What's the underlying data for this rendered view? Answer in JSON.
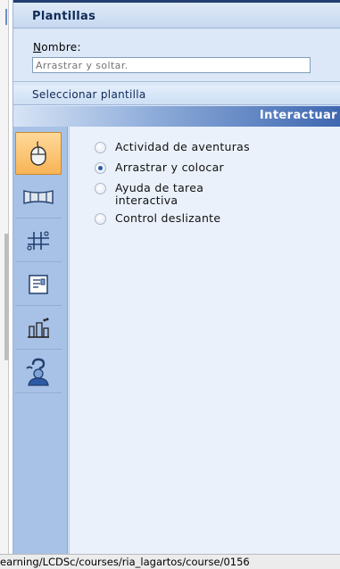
{
  "panel": {
    "title": "Plantillas",
    "name_label_accel": "N",
    "name_label_rest": "ombre:",
    "name_input_placeholder": "Arrastrar y soltar.",
    "select_section_label": "Seleccionar plantilla",
    "category_title": "Interactuar"
  },
  "rail": {
    "items": [
      {
        "icon": "mouse-icon",
        "active": true
      },
      {
        "icon": "film-strip-icon",
        "active": false
      },
      {
        "icon": "slider-controls-icon",
        "active": false
      },
      {
        "icon": "document-icon",
        "active": false
      },
      {
        "icon": "lab-beaker-icon",
        "active": false
      },
      {
        "icon": "person-help-icon",
        "active": false
      }
    ]
  },
  "options": [
    {
      "label": "Actividad de aventuras",
      "selected": false
    },
    {
      "label": "Arrastrar y colocar",
      "selected": true
    },
    {
      "label": "Ayuda de tarea interactiva",
      "selected": false
    },
    {
      "label": "Control deslizante",
      "selected": false
    }
  ],
  "status_bar": {
    "text": "earning/LCDSc/courses/ria_lagartos/course/0156"
  },
  "colors": {
    "title_text": "#0f2a55",
    "category_gradient_end": "#3e67b0",
    "active_rail_item": "#f7b455"
  }
}
